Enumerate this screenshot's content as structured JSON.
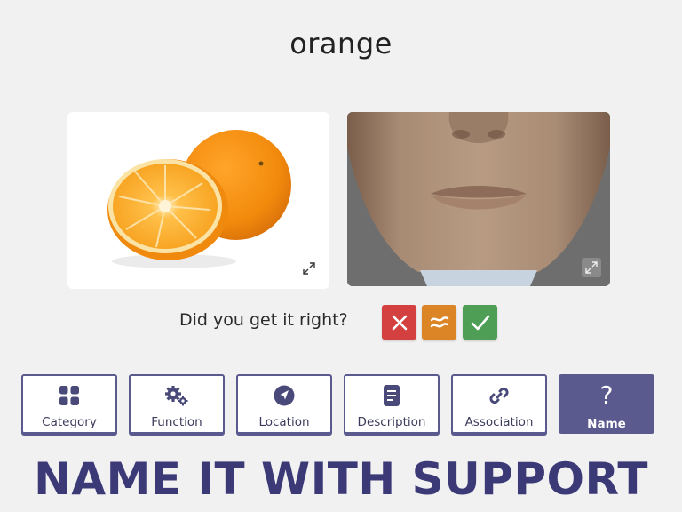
{
  "target_word": "orange",
  "images": {
    "photo_icon": "expand-icon",
    "face_icon": "expand-icon"
  },
  "feedback": {
    "question": "Did you get it right?",
    "buttons": [
      {
        "name": "incorrect",
        "icon": "x-icon",
        "color": "#d43f3f"
      },
      {
        "name": "approximately",
        "icon": "approx-icon",
        "color": "#dc8527"
      },
      {
        "name": "correct",
        "icon": "check-icon",
        "color": "#4f9e55"
      }
    ]
  },
  "cues": [
    {
      "label": "Category",
      "icon": "grid-icon"
    },
    {
      "label": "Function",
      "icon": "gears-icon"
    },
    {
      "label": "Location",
      "icon": "navigation-arrow-icon"
    },
    {
      "label": "Description",
      "icon": "document-icon"
    },
    {
      "label": "Association",
      "icon": "link-icon"
    },
    {
      "label": "Name",
      "icon": "question-mark-icon",
      "active": true
    }
  ],
  "banner": "NAME IT WITH SUPPORT",
  "colors": {
    "accent": "#5b5a8f",
    "banner_text": "#3b3a77",
    "background": "#f1f1f1"
  }
}
